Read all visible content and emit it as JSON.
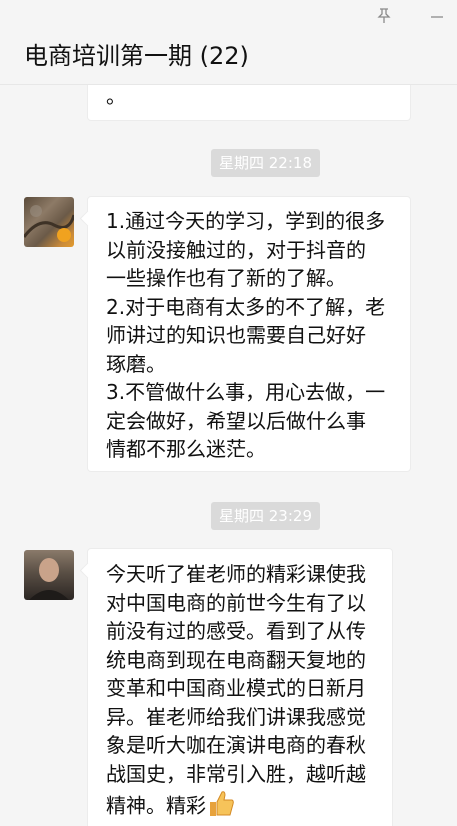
{
  "window": {
    "title": "电商培训第一期 (22)",
    "pin_icon": "pin-icon",
    "minimize_icon": "minimize-icon"
  },
  "messages": [
    {
      "text": "。"
    },
    {
      "timestamp": "星期四 22:18",
      "avatar": "user-avatar-tree",
      "text": "1.通过今天的学习，学到的很多\n以前没接触过的，对于抖音的\n一些操作也有了新的了解。\n2.对于电商有太多的不了解，老\n师讲过的知识也需要自己好好\n琢磨。\n3.不管做什么事，用心去做，一\n定会做好，希望以后做什么事\n情都不那么迷茫。"
    },
    {
      "timestamp": "星期四 23:29",
      "avatar": "user-avatar-man",
      "text": "今天听了崔老师的精彩课使我\n对中国电商的前世今生有了以\n前没有过的感受。看到了从传\n统电商到现在电商翻天复地的\n变革和中国商业模式的日新月\n异。崔老师给我们讲课我感觉\n象是听大咖在演讲电商的春秋\n战国史，非常引入胜，越听越\n精神。精彩",
      "emoji": "thumbs-up-icon"
    }
  ],
  "colors": {
    "background": "#f5f5f5",
    "bubble": "#ffffff",
    "timestamp_bg": "#dadada"
  }
}
